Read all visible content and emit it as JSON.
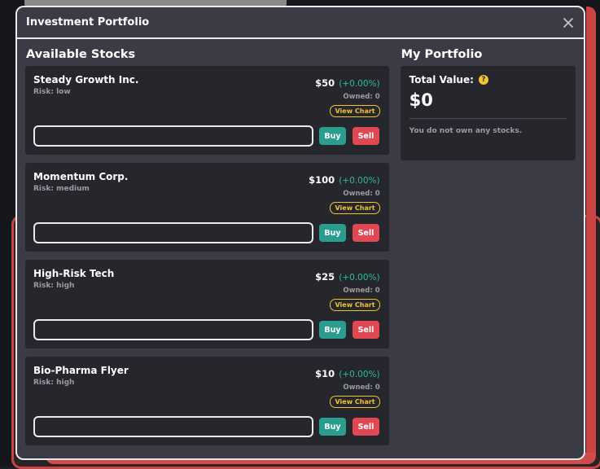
{
  "modal": {
    "title": "Investment Portfolio",
    "close_icon": "close-icon"
  },
  "stocks_section": {
    "title": "Available Stocks",
    "risk_prefix": "Risk: ",
    "owned_prefix": "Owned: ",
    "view_chart_label": "View Chart",
    "buy_label": "Buy",
    "sell_label": "Sell",
    "items": [
      {
        "name": "Steady Growth Inc.",
        "risk": "Risk: low",
        "price": "$50",
        "change": "(+0.00%)",
        "owned": "Owned: 0",
        "quantity": ""
      },
      {
        "name": "Momentum Corp.",
        "risk": "Risk: medium",
        "price": "$100",
        "change": "(+0.00%)",
        "owned": "Owned: 0",
        "quantity": ""
      },
      {
        "name": "High-Risk Tech",
        "risk": "Risk: high",
        "price": "$25",
        "change": "(+0.00%)",
        "owned": "Owned: 0",
        "quantity": ""
      },
      {
        "name": "Bio-Pharma Flyer",
        "risk": "Risk: high",
        "price": "$10",
        "change": "(+0.00%)",
        "owned": "Owned: 0",
        "quantity": ""
      }
    ]
  },
  "portfolio_section": {
    "title": "My Portfolio",
    "total_label": "Total Value:",
    "help_icon_glyph": "?",
    "total_value": "$0",
    "empty_message": "You do not own any stocks."
  },
  "colors": {
    "buy": "#2a9d8f",
    "sell": "#e04854",
    "accent": "#f1c232",
    "positive_change": "#2fb89f",
    "modal_bg": "#3a3b44",
    "card_bg": "#26272d"
  }
}
